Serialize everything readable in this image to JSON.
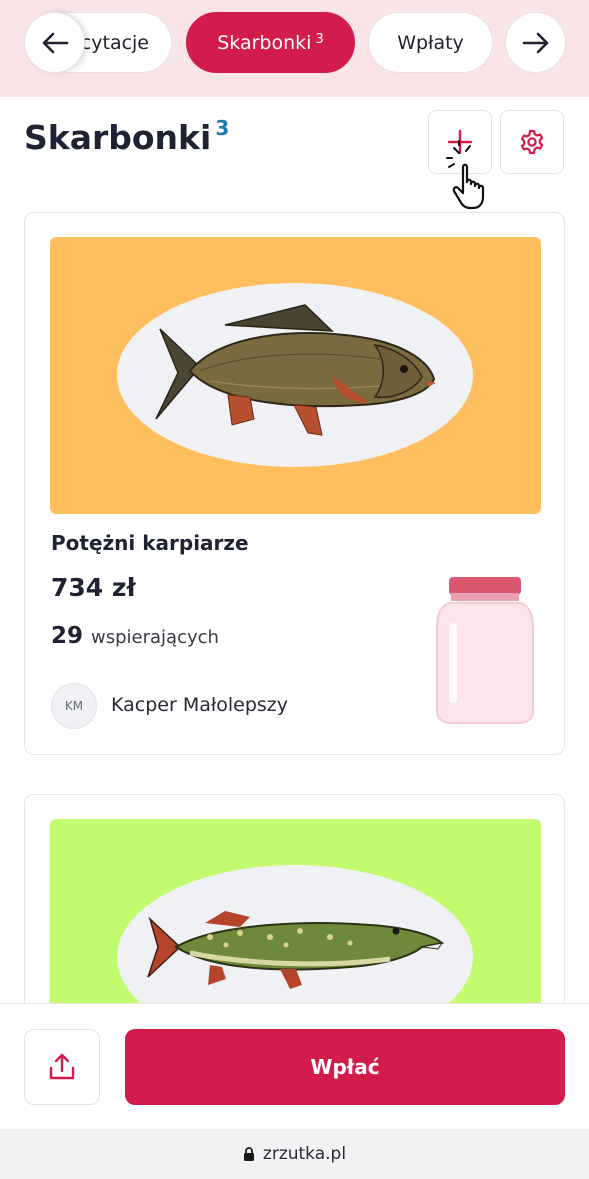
{
  "tabs": {
    "prev_label": "Licytacje",
    "active_label": "Skarbonki",
    "active_count": "3",
    "next_label": "Wpłaty"
  },
  "header": {
    "title": "Skarbonki",
    "count": "3"
  },
  "cards": [
    {
      "title": "Potężni karpiarze",
      "amount": "734 zł",
      "supporters_count": "29",
      "supporters_label": "wspierających",
      "owner_initials": "KM",
      "owner_name": "Kacper Małolepszy",
      "image_bg": "#ffbf5f",
      "image_subject": "carp-fish"
    },
    {
      "image_bg": "#c3fb6f",
      "image_subject": "pike-fish"
    }
  ],
  "bottom": {
    "pay_label": "Wpłać"
  },
  "browser": {
    "url": "zrzutka.pl"
  },
  "colors": {
    "accent": "#d21d4b",
    "tab_bg": "#f9e4e8",
    "count_blue": "#1f7aa5"
  },
  "icons": [
    "arrow-left-icon",
    "arrow-right-icon",
    "plus-icon",
    "gear-icon",
    "hand-pointer-icon",
    "share-icon",
    "lock-icon",
    "jar-icon"
  ]
}
